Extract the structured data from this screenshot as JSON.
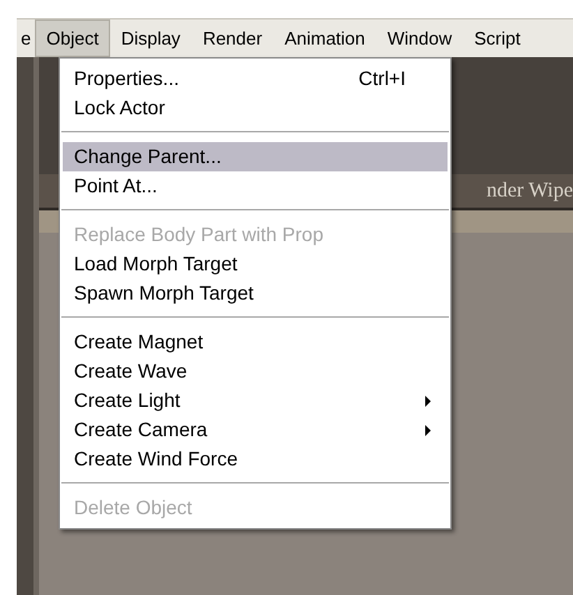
{
  "menubar": [
    {
      "label": "e",
      "selected": false
    },
    {
      "label": "Object",
      "selected": true
    },
    {
      "label": "Display",
      "selected": false
    },
    {
      "label": "Render",
      "selected": false
    },
    {
      "label": "Animation",
      "selected": false
    },
    {
      "label": "Window",
      "selected": false
    },
    {
      "label": "Script",
      "selected": false
    }
  ],
  "background_tab": {
    "label": "nder Wipe"
  },
  "menu": [
    {
      "kind": "item",
      "label": "Properties...",
      "shortcut": "Ctrl+I",
      "disabled": false,
      "selected": false
    },
    {
      "kind": "item",
      "label": "Lock Actor",
      "disabled": false,
      "selected": false
    },
    {
      "kind": "separator"
    },
    {
      "kind": "item",
      "label": "Change Parent...",
      "disabled": false,
      "selected": true
    },
    {
      "kind": "item",
      "label": "Point At...",
      "disabled": false,
      "selected": false
    },
    {
      "kind": "separator"
    },
    {
      "kind": "item",
      "label": "Replace Body Part with Prop",
      "disabled": true,
      "selected": false
    },
    {
      "kind": "item",
      "label": "Load Morph Target",
      "disabled": false,
      "selected": false
    },
    {
      "kind": "item",
      "label": "Spawn Morph Target",
      "disabled": false,
      "selected": false
    },
    {
      "kind": "separator"
    },
    {
      "kind": "item",
      "label": "Create Magnet",
      "disabled": false,
      "selected": false
    },
    {
      "kind": "item",
      "label": "Create Wave",
      "disabled": false,
      "selected": false
    },
    {
      "kind": "item",
      "label": "Create Light",
      "submenu": true,
      "disabled": false,
      "selected": false
    },
    {
      "kind": "item",
      "label": "Create Camera",
      "submenu": true,
      "disabled": false,
      "selected": false
    },
    {
      "kind": "item",
      "label": "Create Wind Force",
      "disabled": false,
      "selected": false
    },
    {
      "kind": "separator"
    },
    {
      "kind": "item",
      "label": "Delete Object",
      "disabled": true,
      "selected": false
    }
  ]
}
